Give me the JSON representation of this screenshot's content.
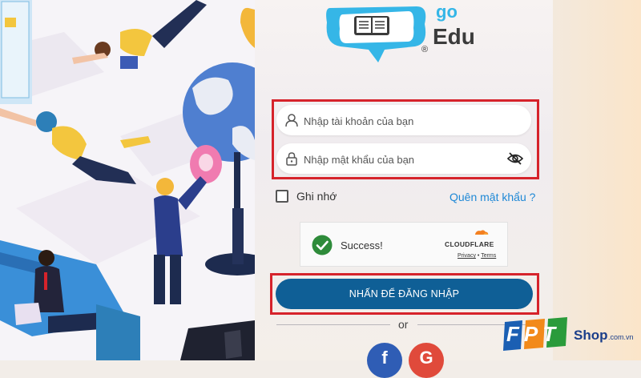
{
  "logo": {
    "prefix": "go",
    "name": "Edu",
    "reg_mark": "®",
    "icon": "book-speech-bubble-icon"
  },
  "login": {
    "username_placeholder": "Nhập tài khoản của bạn",
    "password_placeholder": "Nhập mật khẩu của bạn",
    "remember_label": "Ghi nhớ",
    "remember_checked": false,
    "forgot_label": "Quên mật khẩu ?",
    "submit_label": "NHẤN ĐỂ ĐĂNG NHẬP",
    "or_label": "or"
  },
  "captcha": {
    "status": "Success!",
    "provider": "CLOUDFLARE",
    "privacy_label": "Privacy",
    "separator": "•",
    "terms_label": "Terms"
  },
  "social": {
    "facebook_glyph": "f",
    "google_glyph": "G"
  },
  "watermark": {
    "brand": "FPT",
    "shop": "Shop",
    "domain": ".com.vn"
  },
  "colors": {
    "brand_blue": "#35b6e7",
    "button_blue": "#0f5f96",
    "highlight_red": "#d6232b",
    "link_blue": "#1e88d6",
    "success_green": "#2e8b3a",
    "cloudflare_orange": "#f38020"
  }
}
